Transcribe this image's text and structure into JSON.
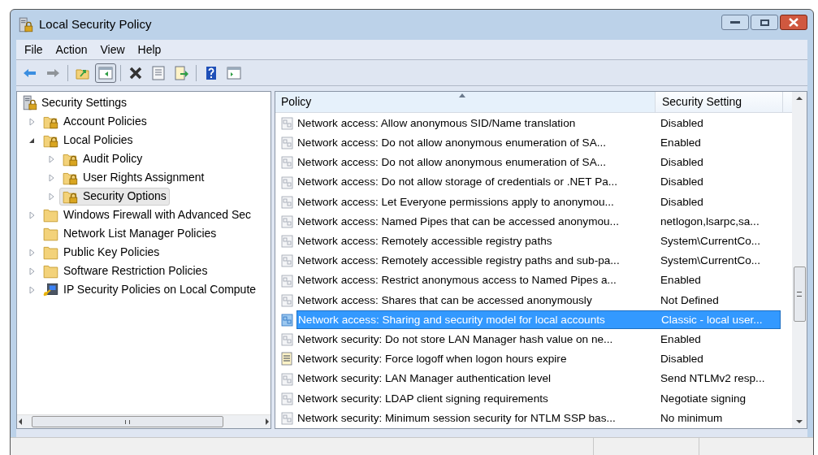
{
  "window": {
    "title": "Local Security Policy"
  },
  "menu": [
    "File",
    "Action",
    "View",
    "Help"
  ],
  "toolbar": {
    "show_tree_pressed": true
  },
  "tree": {
    "label": "Security Settings",
    "kind": "server",
    "children": [
      {
        "label": "Account Policies",
        "kind": "secure-folder",
        "expanded": false,
        "selected": false
      },
      {
        "label": "Local Policies",
        "kind": "secure-folder",
        "expanded": true,
        "selected": false,
        "children": [
          {
            "label": "Audit Policy",
            "kind": "secure-folder",
            "expanded": false,
            "selected": false
          },
          {
            "label": "User Rights Assignment",
            "kind": "secure-folder",
            "expanded": false,
            "selected": false
          },
          {
            "label": "Security Options",
            "kind": "secure-folder",
            "expanded": false,
            "selected": true
          }
        ]
      },
      {
        "label": "Windows Firewall with Advanced Sec",
        "kind": "folder",
        "expanded": false,
        "selected": false
      },
      {
        "label": "Network List Manager Policies",
        "kind": "folder",
        "selected": false
      },
      {
        "label": "Public Key Policies",
        "kind": "folder",
        "expanded": false,
        "selected": false
      },
      {
        "label": "Software Restriction Policies",
        "kind": "folder",
        "expanded": false,
        "selected": false
      },
      {
        "label": "IP Security Policies on Local Compute",
        "kind": "ip-security",
        "expanded": false,
        "selected": false
      }
    ]
  },
  "table": {
    "columns": [
      "Policy",
      "Security Setting"
    ],
    "rows": [
      {
        "policy": "Network access: Allow anonymous SID/Name translation",
        "setting": "Disabled",
        "kind": "policy",
        "selected": false
      },
      {
        "policy": "Network access: Do not allow anonymous enumeration of SA...",
        "setting": "Enabled",
        "kind": "policy",
        "selected": false
      },
      {
        "policy": "Network access: Do not allow anonymous enumeration of SA...",
        "setting": "Disabled",
        "kind": "policy",
        "selected": false
      },
      {
        "policy": "Network access: Do not allow storage of credentials or .NET Pa...",
        "setting": "Disabled",
        "kind": "policy",
        "selected": false
      },
      {
        "policy": "Network access: Let Everyone permissions apply to anonymou...",
        "setting": "Disabled",
        "kind": "policy",
        "selected": false
      },
      {
        "policy": "Network access: Named Pipes that can be accessed anonymou...",
        "setting": "netlogon,lsarpc,sa...",
        "kind": "policy",
        "selected": false
      },
      {
        "policy": "Network access: Remotely accessible registry paths",
        "setting": "System\\CurrentCo...",
        "kind": "policy",
        "selected": false
      },
      {
        "policy": "Network access: Remotely accessible registry paths and sub-pa...",
        "setting": "System\\CurrentCo...",
        "kind": "policy",
        "selected": false
      },
      {
        "policy": "Network access: Restrict anonymous access to Named Pipes a...",
        "setting": "Enabled",
        "kind": "policy",
        "selected": false
      },
      {
        "policy": "Network access: Shares that can be accessed anonymously",
        "setting": "Not Defined",
        "kind": "policy",
        "selected": false
      },
      {
        "policy": "Network access: Sharing and security model for local accounts",
        "setting": "Classic - local user...",
        "kind": "policy",
        "selected": true
      },
      {
        "policy": "Network security: Do not store LAN Manager hash value on ne...",
        "setting": "Enabled",
        "kind": "policy",
        "selected": false
      },
      {
        "policy": "Network security: Force logoff when logon hours expire",
        "setting": "Disabled",
        "kind": "document",
        "selected": false
      },
      {
        "policy": "Network security: LAN Manager authentication level",
        "setting": "Send NTLMv2 resp...",
        "kind": "policy",
        "selected": false
      },
      {
        "policy": "Network security: LDAP client signing requirements",
        "setting": "Negotiate signing",
        "kind": "policy",
        "selected": false
      },
      {
        "policy": "Network security: Minimum session security for NTLM SSP bas...",
        "setting": "No minimum",
        "kind": "policy",
        "selected": false
      }
    ]
  }
}
